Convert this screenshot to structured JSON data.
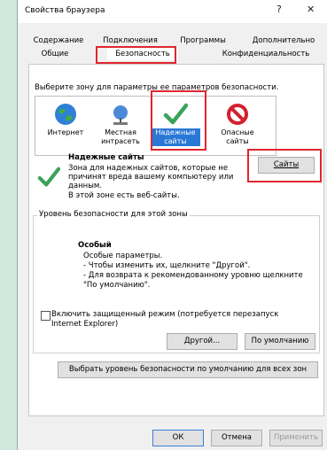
{
  "window": {
    "title": "Свойства браузера",
    "help_glyph": "?",
    "close_glyph": "✕"
  },
  "tabs_row1": [
    "Содержание",
    "Подключения",
    "Программы",
    "Дополнительно"
  ],
  "tabs_row2": [
    "Общие",
    "Безопасность",
    "Конфиденциальность"
  ],
  "security": {
    "zone_prompt": "Выберите зону для параметры ее параметров безопасности.",
    "zones": [
      {
        "line1": "Интернет",
        "line2": "",
        "icon": "globe-icon"
      },
      {
        "line1": "Местная",
        "line2": "интрасеть",
        "icon": "intranet-icon"
      },
      {
        "line1": "Надежные",
        "line2": "сайты",
        "icon": "checkmark-icon"
      },
      {
        "line1": "Опасные",
        "line2": "сайты",
        "icon": "forbidden-icon"
      }
    ],
    "selected_zone": "Надежные сайты",
    "zone_title": "Надежные сайты",
    "zone_desc_1": "Зона для надежных сайтов, которые не",
    "zone_desc_2": "причинят вреда вашему компьютеру или",
    "zone_desc_3": "данным.",
    "zone_desc_4": "В этой зоне есть веб-сайты.",
    "sites_button": "Сайты",
    "level_group_title": "Уровень безопасности для этой зоны",
    "level_name": "Особый",
    "level_line_1": "Особые параметры.",
    "level_line_2": "- Чтобы изменить их, щелкните \"Другой\".",
    "level_line_3": "- Для возврата к рекомендованному уровню щелкните",
    "level_line_4": "\"По умолчанию\".",
    "protected_mode_line_1": "Включить защищенный режим (потребуется перезапуск",
    "protected_mode_line_2": "Internet Explorer)",
    "protected_mode_checked": false,
    "custom_button": "Другой...",
    "default_button": "По умолчанию",
    "all_default_button": "Выбрать уровень безопасности по умолчанию для всех зон"
  },
  "footer": {
    "ok": "ОК",
    "cancel": "Отмена",
    "apply": "Применить"
  },
  "colors": {
    "highlight_red": "#e0262f",
    "selection_blue": "#2a78d6",
    "background": "#cfe9dc"
  }
}
